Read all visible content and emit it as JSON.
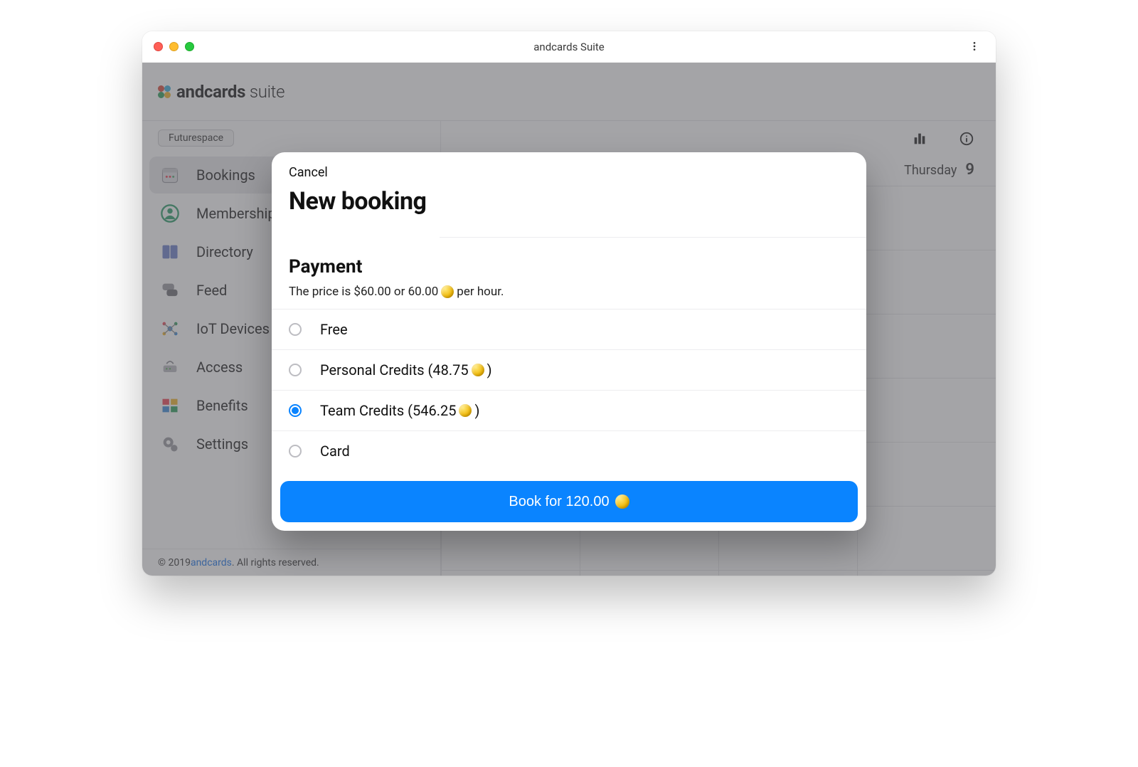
{
  "window": {
    "title": "andcards Suite"
  },
  "brand": {
    "name_bold": "andcards",
    "name_light": "suite"
  },
  "workspace": {
    "name": "Futurespace"
  },
  "sidebar": {
    "items": [
      {
        "label": "Bookings",
        "icon": "calendar"
      },
      {
        "label": "Membership",
        "icon": "person"
      },
      {
        "label": "Directory",
        "icon": "book"
      },
      {
        "label": "Feed",
        "icon": "chat"
      },
      {
        "label": "IoT Devices",
        "icon": "network"
      },
      {
        "label": "Access",
        "icon": "router"
      },
      {
        "label": "Benefits",
        "icon": "squares"
      },
      {
        "label": "Settings",
        "icon": "gears"
      }
    ],
    "active_index": 0
  },
  "calendar": {
    "day_label": "Thursday",
    "day_num": "9"
  },
  "footer": {
    "copyright_prefix": "© 2019 ",
    "link": "andcards",
    "copyright_suffix": ". All rights reserved."
  },
  "modal": {
    "cancel": "Cancel",
    "title": "New booking",
    "section": "Payment",
    "price_prefix": "The price is $60.00 or 60.00",
    "price_suffix": " per hour.",
    "options": {
      "free": "Free",
      "personal_prefix": "Personal Credits (48.75",
      "personal_suffix": " )",
      "team_prefix": "Team Credits (546.25",
      "team_suffix": " )",
      "card": "Card"
    },
    "selected": "team",
    "button_prefix": "Book for 120.00"
  }
}
